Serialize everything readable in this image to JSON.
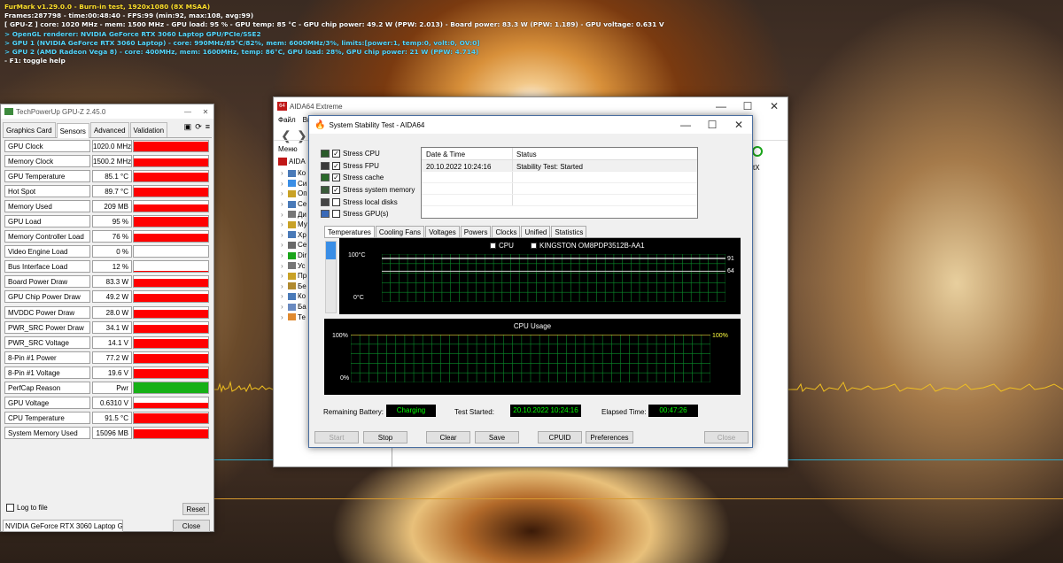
{
  "furmark": {
    "line1": "FurMark v1.29.0.0 - Burn-in test, 1920x1080 (8X MSAA)",
    "line2": "Frames:287798 - time:00:48:40 - FPS:99 (min:92, max:108, avg:99)",
    "line3": "[ GPU-Z ] core: 1020 MHz - mem: 1500 MHz - GPU load: 95 % - GPU temp: 85 °C - GPU chip power: 49.2 W (PPW: 2.013) - Board power: 83.3 W (PPW: 1.189) - GPU voltage: 0.631 V",
    "line4": "> OpenGL renderer: NVIDIA GeForce RTX 3060 Laptop GPU/PCIe/SSE2",
    "line5": "> GPU 1 (NVIDIA GeForce RTX 3060 Laptop) - core: 990MHz/85°C/82%, mem: 6000MHz/3%, limits:[power:1, temp:0, volt:0, OV:0]",
    "line6": "> GPU 2 (AMD Radeon Vega 8) - core: 400MHz, mem: 1600MHz, temp: 86°C, GPU load: 28%, GPU chip power: 21 W (PPW: 4.714)",
    "line7": "- F1: toggle help"
  },
  "gpuz": {
    "title": "TechPowerUp GPU-Z 2.45.0",
    "tabs": [
      "Graphics Card",
      "Sensors",
      "Advanced",
      "Validation"
    ],
    "rows": [
      {
        "label": "GPU Clock",
        "value": "1020.0 MHz",
        "level": 0.85,
        "color": "#ff0000"
      },
      {
        "label": "Memory Clock",
        "value": "1500.2 MHz",
        "level": 0.75,
        "color": "#ff0000"
      },
      {
        "label": "GPU Temperature",
        "value": "85.1 °C",
        "level": 0.8,
        "color": "#ff0000"
      },
      {
        "label": "Hot Spot",
        "value": "89.7 °C",
        "level": 0.8,
        "color": "#ff0000"
      },
      {
        "label": "Memory Used",
        "value": "209 MB",
        "level": 0.7,
        "color": "#ff0000"
      },
      {
        "label": "GPU Load",
        "value": "95 %",
        "level": 0.95,
        "color": "#ff0000"
      },
      {
        "label": "Memory Controller Load",
        "value": "76 %",
        "level": 0.76,
        "color": "#ff0000"
      },
      {
        "label": "Video Engine Load",
        "value": "0 %",
        "level": 0,
        "color": "#ff0000"
      },
      {
        "label": "Bus Interface Load",
        "value": "12 %",
        "level": 0.12,
        "color": "#ff0000"
      },
      {
        "label": "Board Power Draw",
        "value": "83.3 W",
        "level": 0.8,
        "color": "#ff0000"
      },
      {
        "label": "GPU Chip Power Draw",
        "value": "49.2 W",
        "level": 0.75,
        "color": "#ff0000"
      },
      {
        "label": "MVDDC Power Draw",
        "value": "28.0 W",
        "level": 0.75,
        "color": "#ff0000"
      },
      {
        "label": "PWR_SRC Power Draw",
        "value": "34.1 W",
        "level": 0.75,
        "color": "#ff0000"
      },
      {
        "label": "PWR_SRC Voltage",
        "value": "14.1 V",
        "level": 0.85,
        "color": "#ff0000"
      },
      {
        "label": "8-Pin #1 Power",
        "value": "77.2 W",
        "level": 0.8,
        "color": "#ff0000"
      },
      {
        "label": "8-Pin #1 Voltage",
        "value": "19.6 V",
        "level": 0.85,
        "color": "#ff0000"
      },
      {
        "label": "PerfCap Reason",
        "value": "Pwr",
        "level": 1,
        "color": "#16b016"
      },
      {
        "label": "GPU Voltage",
        "value": "0.6310 V",
        "level": 0.5,
        "color": "#ff0000"
      },
      {
        "label": "CPU Temperature",
        "value": "91.5 °C",
        "level": 0.9,
        "color": "#ff0000"
      },
      {
        "label": "System Memory Used",
        "value": "15096 MB",
        "level": 0.9,
        "color": "#ff0000"
      }
    ],
    "log_to_file": "Log to file",
    "reset": "Reset",
    "device": "NVIDIA GeForce RTX 3060 Laptop GPU",
    "close": "Close"
  },
  "aida": {
    "title": "AIDA64 Extreme",
    "menu_file": "Файл",
    "menu_view": "Ви",
    "menu_label": "Меню",
    "tree_root": "AIDA",
    "tree_items": [
      "Ко",
      "Си",
      "Оп",
      "Се",
      "Ди",
      "Му",
      "Хр",
      "Се",
      "Dir",
      "Ус",
      "Пр",
      "Бе",
      "Ко",
      "Ба",
      "Те"
    ],
    "right_fragment": "tX"
  },
  "sst": {
    "title": "System Stability Test - AIDA64",
    "stress": [
      {
        "label": "Stress CPU",
        "checked": "✓"
      },
      {
        "label": "Stress FPU",
        "checked": "✓"
      },
      {
        "label": "Stress cache",
        "checked": "✓"
      },
      {
        "label": "Stress system memory",
        "checked": "✓"
      },
      {
        "label": "Stress local disks",
        "checked": ""
      },
      {
        "label": "Stress GPU(s)",
        "checked": ""
      }
    ],
    "log_header": {
      "date": "Date & Time",
      "status": "Status"
    },
    "log_rows": [
      {
        "date": "20.10.2022 10:24:16",
        "status": "Stability Test: Started"
      }
    ],
    "tabs": [
      "Temperatures",
      "Cooling Fans",
      "Voltages",
      "Powers",
      "Clocks",
      "Unified",
      "Statistics"
    ],
    "temp_graph": {
      "legend_cpu": "CPU",
      "legend_disk": "KINGSTON OM8PDP3512B-AA1",
      "y_max": "100°C",
      "y_min": "0°C",
      "val1": "91",
      "val2": "64",
      "level1": 0.91,
      "level2": 0.64
    },
    "usage_graph": {
      "title": "CPU Usage",
      "y_max": "100%",
      "y_min": "0%",
      "val": "100%",
      "level": 1.0
    },
    "remaining_battery_label": "Remaining Battery:",
    "remaining_battery": "Charging",
    "test_started_label": "Test Started:",
    "test_started": "20.10.2022 10:24:16",
    "elapsed_label": "Elapsed Time:",
    "elapsed": "00:47:26",
    "buttons": {
      "start": "Start",
      "stop": "Stop",
      "clear": "Clear",
      "save": "Save",
      "cpuid": "CPUID",
      "preferences": "Preferences",
      "close": "Close"
    },
    "colors": {
      "grid": "#0a8a2a",
      "line": "#e8d23a",
      "value": "#ffff40"
    }
  }
}
